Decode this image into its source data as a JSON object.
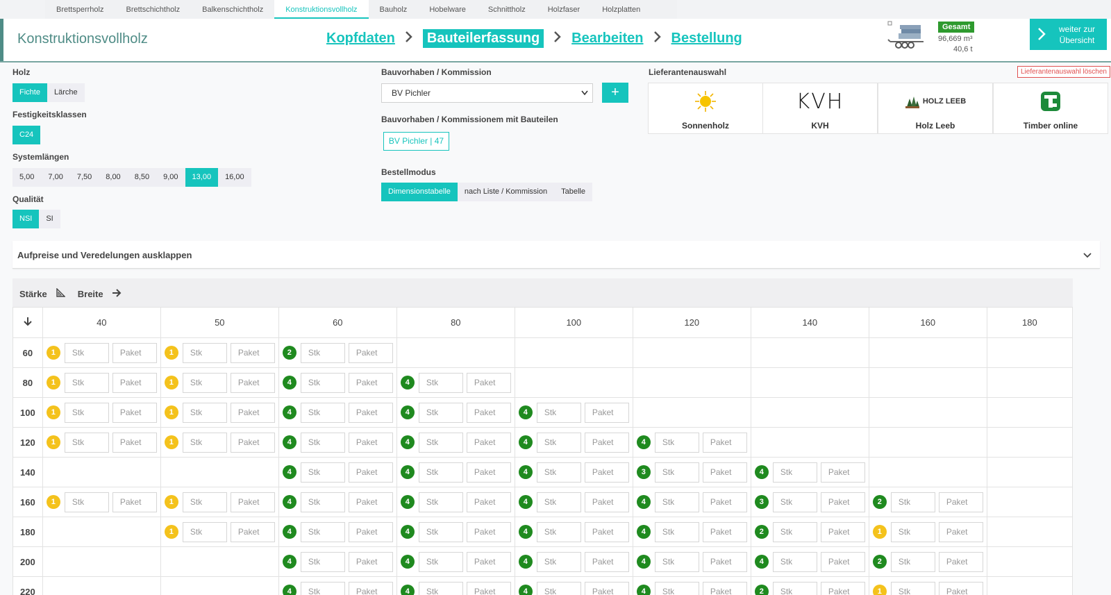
{
  "topnav": [
    "Brettsperrholz",
    "Brettschichtholz",
    "Balkenschichtholz",
    "Konstruktionsvollholz",
    "Bauholz",
    "Hobelware",
    "Schnittholz",
    "Holzfaser",
    "Holzplatten"
  ],
  "topnav_active": 3,
  "header": {
    "title": "Konstruktionsvollholz",
    "steps": [
      "Kopfdaten",
      "Bauteilerfassung",
      "Bearbeiten",
      "Bestellung"
    ],
    "active_step": 1,
    "gesamt_label": "Gesamt",
    "volume": "96,669 m³",
    "weight": "40,6 t",
    "weiter_line1": "weiter zur",
    "weiter_line2": "Übersicht"
  },
  "left": {
    "holz_label": "Holz",
    "holz": [
      "Fichte",
      "Lärche"
    ],
    "festigkeit_label": "Festigkeitsklassen",
    "festigkeit": [
      "C24"
    ],
    "system_label": "Systemlängen",
    "system": [
      "5,00",
      "7,00",
      "7,50",
      "8,00",
      "8,50",
      "9,00",
      "13,00",
      "16,00"
    ],
    "system_active": 6,
    "qualitaet_label": "Qualität",
    "qualitaet": [
      "NSI",
      "SI"
    ]
  },
  "middle": {
    "bauvorhaben_label": "Bauvorhaben / Kommission",
    "bauvorhaben_value": "BV Pichler",
    "mit_bauteilen_label": "Bauvorhaben / Kommissionem mit Bauteilen",
    "mit_bauteilen_tag": "BV Pichler | 47",
    "bestellmodus_label": "Bestellmodus",
    "bestellmodus": [
      "Dimensionstabelle",
      "nach Liste / Kommission",
      "Tabelle"
    ]
  },
  "suppliers": {
    "label": "Lieferantenauswahl",
    "clear": "Lieferantenauswahl löschen",
    "items": [
      "Sonnenholz",
      "KVH",
      "Holz Leeb",
      "Timber online"
    ],
    "kvh_logo": "KVH",
    "leeb_logo": "HOLZ LEEB"
  },
  "collapse_title": "Aufpreise und Veredelungen ausklappen",
  "grid": {
    "staerke_label": "Stärke",
    "breite_label": "Breite",
    "stk": "Stk",
    "paket": "Paket",
    "columns": [
      "40",
      "50",
      "60",
      "80",
      "100",
      "120",
      "140",
      "160",
      "180"
    ],
    "rows": [
      {
        "h": "60",
        "c": [
          "1y",
          "1y",
          "2g",
          "",
          "",
          "",
          "",
          "",
          ""
        ]
      },
      {
        "h": "80",
        "c": [
          "1y",
          "1y",
          "4g",
          "4g",
          "",
          "",
          "",
          "",
          ""
        ]
      },
      {
        "h": "100",
        "c": [
          "1y",
          "1y",
          "4g",
          "4g",
          "4g",
          "",
          "",
          "",
          ""
        ]
      },
      {
        "h": "120",
        "c": [
          "1y",
          "1y",
          "4g",
          "4g",
          "4g",
          "4g",
          "",
          "",
          ""
        ]
      },
      {
        "h": "140",
        "c": [
          "",
          "",
          "4g",
          "4g",
          "4g",
          "3g",
          "4g",
          "",
          ""
        ]
      },
      {
        "h": "160",
        "c": [
          "1y",
          "1y",
          "4g",
          "4g",
          "4g",
          "4g",
          "3g",
          "2g",
          ""
        ]
      },
      {
        "h": "180",
        "c": [
          "",
          "1y",
          "4g",
          "4g",
          "4g",
          "4g",
          "2g",
          "1y",
          ""
        ]
      },
      {
        "h": "200",
        "c": [
          "",
          "",
          "4g",
          "4g",
          "4g",
          "4g",
          "4g",
          "2g",
          ""
        ]
      },
      {
        "h": "220",
        "c": [
          "",
          "",
          "4g",
          "4g",
          "4g",
          "4g",
          "2g",
          "1y",
          ""
        ]
      }
    ]
  }
}
